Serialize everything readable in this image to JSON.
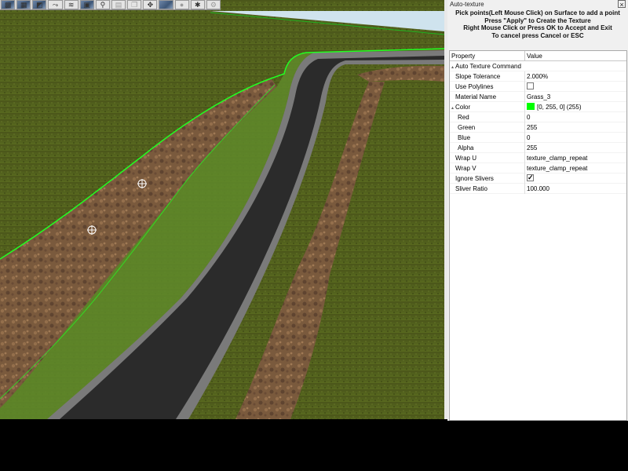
{
  "toolbar": {
    "tools": [
      {
        "icon": "terrain-icon",
        "glyph": "▩",
        "style": "img"
      },
      {
        "icon": "texture-icon",
        "glyph": "▦",
        "style": "img"
      },
      {
        "icon": "mesh-icon",
        "glyph": "◩",
        "style": "img"
      },
      {
        "icon": "path-icon",
        "glyph": "⤳",
        "style": ""
      },
      {
        "icon": "road-icon",
        "glyph": "≋",
        "style": ""
      },
      {
        "icon": "object-icon",
        "glyph": "▣",
        "style": "img"
      },
      {
        "icon": "zoom-icon",
        "glyph": "⚲",
        "style": ""
      },
      {
        "icon": "paste-icon",
        "glyph": "▤",
        "style": "dim"
      },
      {
        "icon": "copy-icon",
        "glyph": "❐",
        "style": "dim"
      },
      {
        "icon": "move-icon",
        "glyph": "✥",
        "style": ""
      },
      {
        "icon": "sky-icon",
        "glyph": "",
        "style": "img"
      },
      {
        "icon": "record-icon",
        "glyph": "●",
        "style": "dim"
      },
      {
        "icon": "asterisk-icon",
        "glyph": "✱",
        "style": ""
      },
      {
        "icon": "settings-icon",
        "glyph": "⚙",
        "style": "dim"
      }
    ]
  },
  "panel": {
    "title": "Auto-texture",
    "close_glyph": "×",
    "instructions": [
      "Pick points(Left Mouse Click) on Surface to add a point",
      "Press \"Apply\" to Create the Texture",
      "Right Mouse Click or Press OK to Accept and Exit",
      "To cancel press Cancel or ESC"
    ]
  },
  "grid": {
    "headers": {
      "property": "Property",
      "value": "Value"
    },
    "category": "Auto Texture Command",
    "collapse_glyph": "▴",
    "color_collapse_glyph": "▴",
    "rows": {
      "slope_tolerance": {
        "label": "Slope Tolerance",
        "value": "2.000%"
      },
      "use_polylines": {
        "label": "Use Polylines",
        "checked": false
      },
      "material_name": {
        "label": "Material Name",
        "value": "Grass_3"
      },
      "color": {
        "label": "Color",
        "value": "[0, 255, 0] (255)",
        "swatch": "#00ff00"
      },
      "red": {
        "label": "Red",
        "value": "0"
      },
      "green": {
        "label": "Green",
        "value": "255"
      },
      "blue": {
        "label": "Blue",
        "value": "0"
      },
      "alpha": {
        "label": "Alpha",
        "value": "255"
      },
      "wrap_u": {
        "label": "Wrap U",
        "value": "texture_clamp_repeat"
      },
      "wrap_v": {
        "label": "Wrap V",
        "value": "texture_clamp_repeat"
      },
      "ignore_slivers": {
        "label": "Ignore Slivers",
        "checked": true,
        "check_glyph": "✓"
      },
      "sliver_ratio": {
        "label": "Sliver Ratio",
        "value": "100.000"
      }
    }
  },
  "colors": {
    "grass": "#4f5a1c",
    "road": "#2a2a2a",
    "dirt": "#7b5a3c",
    "selection": "#00ff00",
    "sky": "#c4dcea"
  }
}
